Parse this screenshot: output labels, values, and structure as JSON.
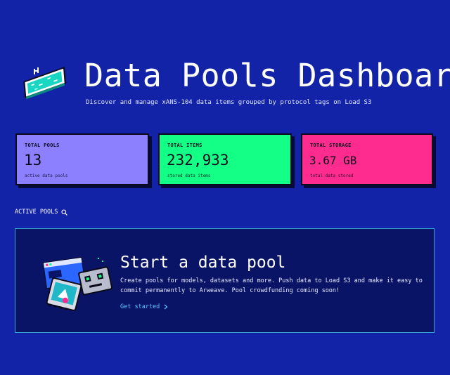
{
  "header": {
    "title": "Data Pools Dashboard",
    "subtitle": "Discover and manage xANS-104 data items grouped by protocol tags on Load S3",
    "logo_icon": "pool-icon"
  },
  "stats": [
    {
      "label": "TOTAL POOLS",
      "value": "13",
      "sub": "active data pools",
      "color": "#8c80ff"
    },
    {
      "label": "TOTAL ITEMS",
      "value": "232,933",
      "sub": "stored data items",
      "color": "#14ff86"
    },
    {
      "label": "TOTAL STORAGE",
      "value": "3.67 GB",
      "sub": "total data stored",
      "color": "#ff2c8f"
    }
  ],
  "section": {
    "label": "ACTIVE POOLS",
    "icon": "search-icon"
  },
  "cta": {
    "title": "Start a data pool",
    "description": "Create pools for models, datasets and more. Push data to Load S3 and make it easy to commit permanently to Arweave. Pool crowdfunding coming soon!",
    "link": "Get started",
    "link_icon": "chevron-right-icon",
    "illustration": "data-cards-illustration"
  },
  "colors": {
    "background": "#1323a8",
    "panel": "#0a1466",
    "panel_border": "#3aa0d0",
    "link": "#5cc8ff"
  }
}
